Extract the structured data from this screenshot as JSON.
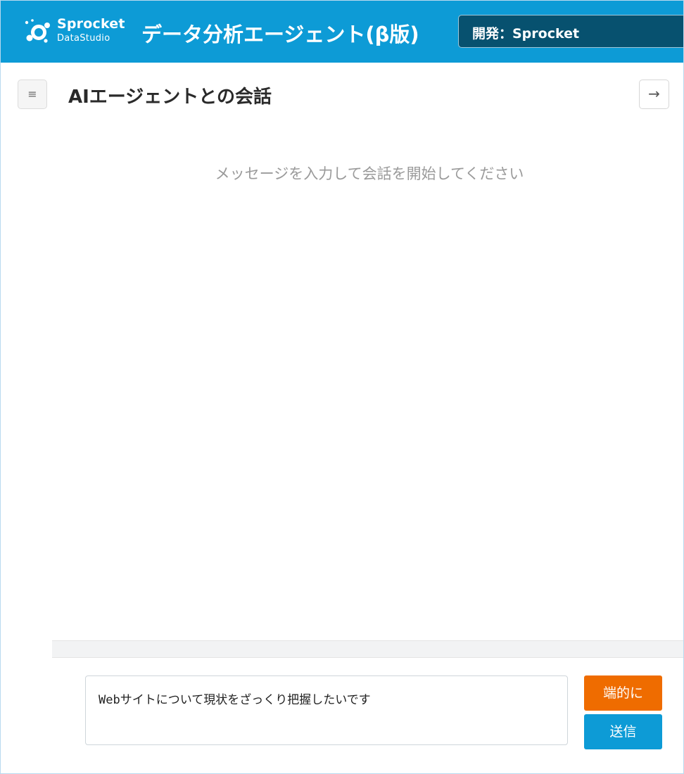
{
  "header": {
    "brand_name": "Sprocket",
    "brand_sub": "DataStudio",
    "app_title": "データ分析エージェント(β版)",
    "dev_badge": "開発：Sprocket",
    "bg_color": "#0d9bd6"
  },
  "chat": {
    "menu_icon": "≡",
    "title": "AIエージェントとの会話",
    "arrow_icon": "→",
    "empty_message": "メッセージを入力して会話を開始してください"
  },
  "composer": {
    "input_value": "Webサイトについて現状をざっくり把握したいです",
    "concise_label": "端的に",
    "send_label": "送信",
    "concise_color": "#ef6c00",
    "send_color": "#0d9bd6"
  }
}
